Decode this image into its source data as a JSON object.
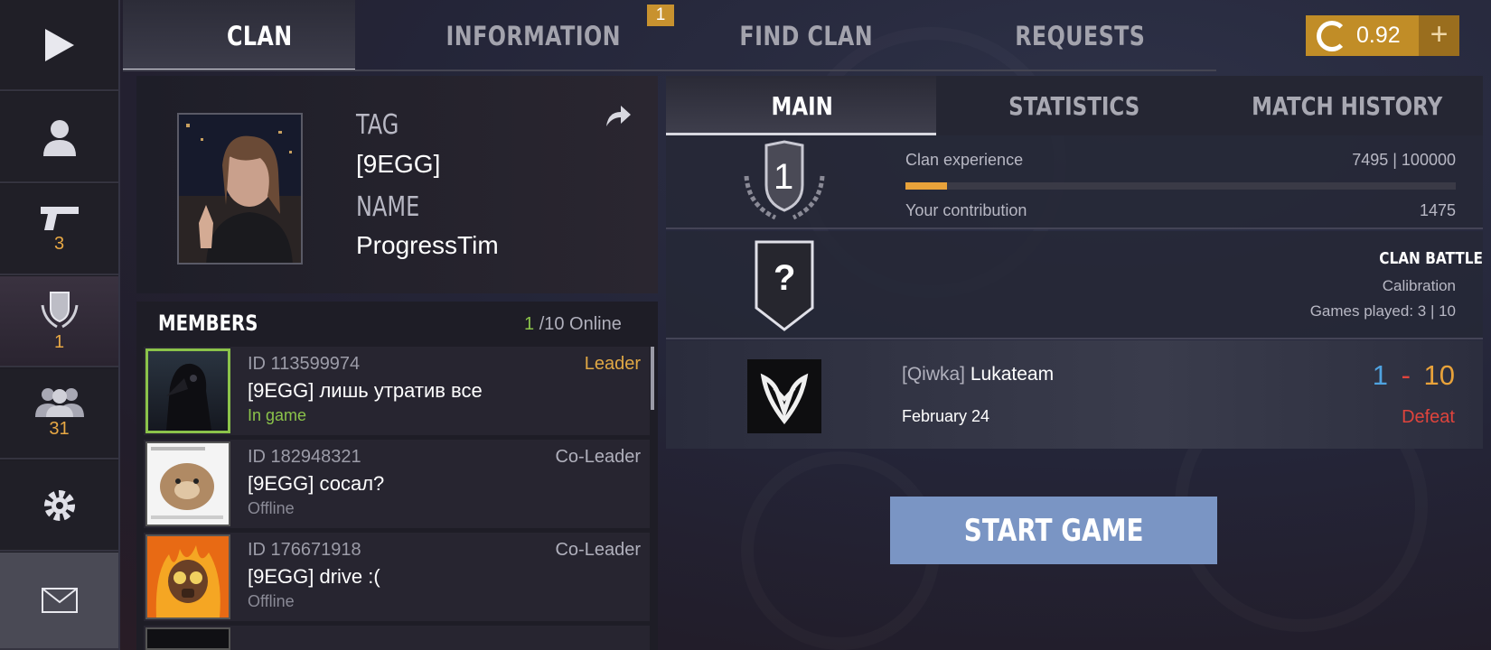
{
  "sidebar": {
    "items": [
      {
        "icon": "play-icon"
      },
      {
        "icon": "profile-icon"
      },
      {
        "icon": "pistol-icon",
        "badge": "3"
      },
      {
        "icon": "clan-shield-icon",
        "badge": "1"
      },
      {
        "icon": "friends-icon",
        "badge": "31"
      },
      {
        "icon": "gear-icon"
      },
      {
        "icon": "mail-icon"
      }
    ]
  },
  "top_tabs": [
    {
      "label": "CLAN",
      "active": true
    },
    {
      "label": "INFORMATION",
      "badge": "1"
    },
    {
      "label": "FIND CLAN"
    },
    {
      "label": "REQUESTS"
    }
  ],
  "currency": {
    "value": "0.92",
    "icon": "gold-g-icon",
    "add": "+"
  },
  "clan": {
    "tag_label": "TAG",
    "tag": "[9EGG]",
    "name_label": "NAME",
    "name": "ProgressTim"
  },
  "members": {
    "title": "MEMBERS",
    "online_count": "1",
    "online_rest": "/10 Online",
    "list": [
      {
        "id": "ID 113599974",
        "name": "[9EGG] лишь утратив все",
        "status": "In game",
        "role": "Leader"
      },
      {
        "id": "ID 182948321",
        "name": "[9EGG] сосал?",
        "status": "Offline",
        "role": "Co-Leader"
      },
      {
        "id": "ID 176671918",
        "name": "[9EGG] drive :(",
        "status": "Offline",
        "role": "Co-Leader"
      }
    ]
  },
  "right_tabs": [
    {
      "label": "MAIN",
      "active": true
    },
    {
      "label": "STATISTICS"
    },
    {
      "label": "MATCH HISTORY"
    }
  ],
  "level": {
    "value": "1",
    "exp_label": "Clan experience",
    "exp_value": "7495 | 100000",
    "exp_progress": 0.075,
    "contrib_label": "Your contribution",
    "contrib_value": "1475"
  },
  "battle": {
    "rank_symbol": "?",
    "title": "CLAN BATTLE",
    "status": "Calibration",
    "games": "Games played: 3 | 10"
  },
  "match": {
    "team_tag": "[Qiwka]",
    "team_name": "Lukateam",
    "date": "February 24",
    "score_left": "1",
    "score_sep": "-",
    "score_right": "10",
    "result": "Defeat",
    "colors": {
      "left": "#4fa3e0",
      "right": "#e8a23a",
      "result": "#e0443c"
    }
  },
  "start_button": "START GAME",
  "colors": {
    "accent": "#e8a23a",
    "online": "#8bc34a",
    "button": "#7a95c4"
  }
}
